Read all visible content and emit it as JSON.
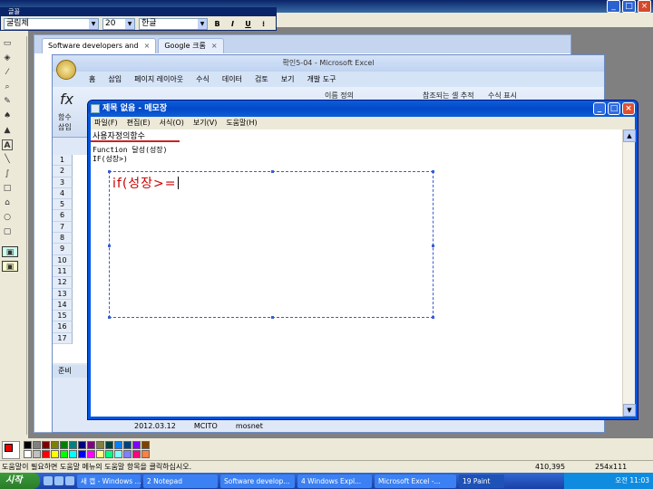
{
  "paint": {
    "title": "...",
    "status_text": "도움말이 필요하면 도움말 메뉴의 도움말 항목을 클릭하십시오.",
    "cursor_coord": "410,395",
    "selection_size": "254x111",
    "colors": [
      "#000000",
      "#808080",
      "#800000",
      "#808000",
      "#008000",
      "#008080",
      "#000080",
      "#800080",
      "#808040",
      "#004040",
      "#0080ff",
      "#004080",
      "#8000ff",
      "#804000",
      "#ffffff",
      "#c0c0c0",
      "#ff0000",
      "#ffff00",
      "#00ff00",
      "#00ffff",
      "#0000ff",
      "#ff00ff",
      "#ffff80",
      "#00ff80",
      "#80ffff",
      "#8080ff",
      "#ff0080",
      "#ff8040"
    ]
  },
  "fontbar": {
    "title": "글꼴",
    "font": "굴림체",
    "size": "20",
    "script": "한글",
    "bold": "B",
    "italic": "I",
    "underline": "U",
    "vertical": "⁞"
  },
  "browser": {
    "tabs": [
      "Software developers and",
      "Google 크롬"
    ]
  },
  "excel": {
    "title": "확인5-04 - Microsoft Excel",
    "tabs": [
      "홈",
      "삽입",
      "페이지 레이아웃",
      "수식",
      "데이터",
      "검토",
      "보기",
      "개발 도구"
    ],
    "ribbon_fx_label": "함수 삽입",
    "ribbon_name_label": "이름 정의",
    "ribbon_trace_label": "참조되는 셀 추적",
    "ribbon_show_label": "수식 표시",
    "rows": [
      "1",
      "2",
      "3",
      "4",
      "5",
      "6",
      "7",
      "8",
      "9",
      "10",
      "11",
      "12",
      "13",
      "14",
      "15",
      "16",
      "17"
    ],
    "status": "준비",
    "bottom_row": [
      "2012.03.12",
      "MCITO",
      "mosnet"
    ]
  },
  "notepad": {
    "title": "제목 없음 - 메모장",
    "menu": [
      "파일(F)",
      "편집(E)",
      "서식(O)",
      "보기(V)",
      "도움말(H)"
    ],
    "heading": "사용자정의함수",
    "line1": "Function 달성(성장)",
    "line2": "IF(성장>)",
    "textbox_text": "if(성장>="
  },
  "taskbar": {
    "start": "시작",
    "tasks": [
      "새 캡 - Windows ...",
      "2 Notepad",
      "Software develop...",
      "4 Windows Expl...",
      "Microsoft Excel -...",
      "19 Paint"
    ],
    "clock": "오전 11:03"
  }
}
